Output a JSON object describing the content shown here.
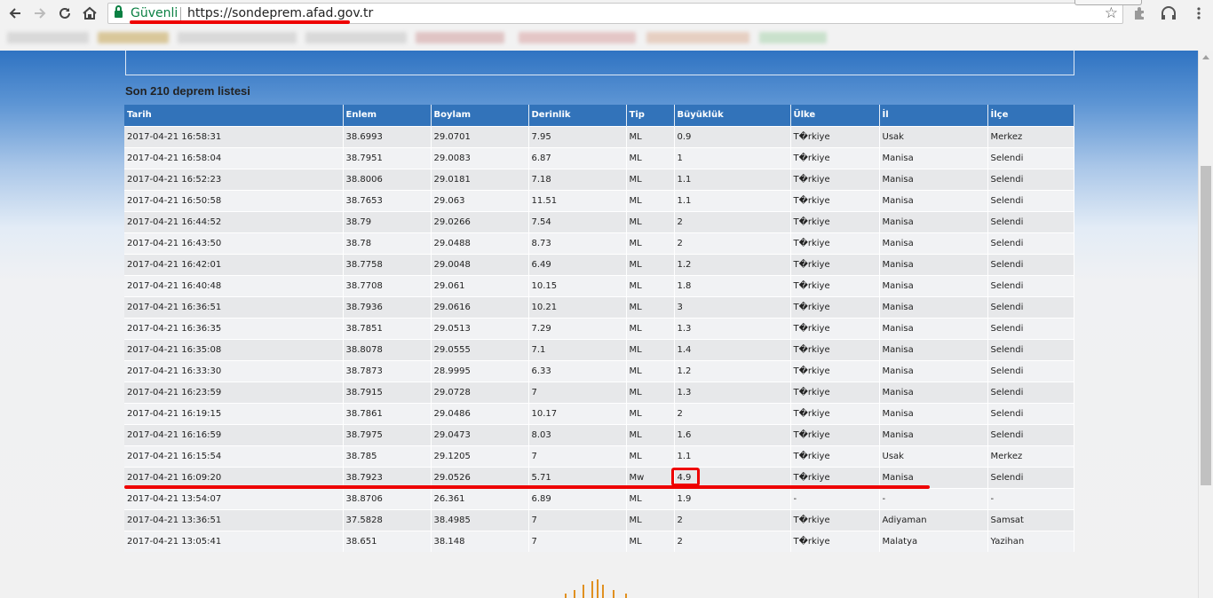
{
  "browser": {
    "secure_label": "Güvenli",
    "url": "https://sondeprem.afad.gov.tr",
    "icons": [
      "back-arrow-icon",
      "forward-arrow-icon",
      "reload-icon",
      "home-icon",
      "lock-icon",
      "star-icon",
      "puzzle-icon",
      "headphones-icon",
      "menu-dots-icon"
    ]
  },
  "page": {
    "section_title": "Son 210 deprem listesi"
  },
  "table": {
    "headers": [
      "Tarih",
      "Enlem",
      "Boylam",
      "Derinlik",
      "Tip",
      "Büyüklük",
      "Ülke",
      "İl",
      "İlçe"
    ],
    "rows": [
      [
        "2017-04-21 16:58:31",
        "38.6993",
        "29.0701",
        "7.95",
        "ML",
        "0.9",
        "T�rkiye",
        "Usak",
        "Merkez"
      ],
      [
        "2017-04-21 16:58:04",
        "38.7951",
        "29.0083",
        "6.87",
        "ML",
        "1",
        "T�rkiye",
        "Manisa",
        "Selendi"
      ],
      [
        "2017-04-21 16:52:23",
        "38.8006",
        "29.0181",
        "7.18",
        "ML",
        "1.1",
        "T�rkiye",
        "Manisa",
        "Selendi"
      ],
      [
        "2017-04-21 16:50:58",
        "38.7653",
        "29.063",
        "11.51",
        "ML",
        "1.1",
        "T�rkiye",
        "Manisa",
        "Selendi"
      ],
      [
        "2017-04-21 16:44:52",
        "38.79",
        "29.0266",
        "7.54",
        "ML",
        "2",
        "T�rkiye",
        "Manisa",
        "Selendi"
      ],
      [
        "2017-04-21 16:43:50",
        "38.78",
        "29.0488",
        "8.73",
        "ML",
        "2",
        "T�rkiye",
        "Manisa",
        "Selendi"
      ],
      [
        "2017-04-21 16:42:01",
        "38.7758",
        "29.0048",
        "6.49",
        "ML",
        "1.2",
        "T�rkiye",
        "Manisa",
        "Selendi"
      ],
      [
        "2017-04-21 16:40:48",
        "38.7708",
        "29.061",
        "10.15",
        "ML",
        "1.8",
        "T�rkiye",
        "Manisa",
        "Selendi"
      ],
      [
        "2017-04-21 16:36:51",
        "38.7936",
        "29.0616",
        "10.21",
        "ML",
        "3",
        "T�rkiye",
        "Manisa",
        "Selendi"
      ],
      [
        "2017-04-21 16:36:35",
        "38.7851",
        "29.0513",
        "7.29",
        "ML",
        "1.3",
        "T�rkiye",
        "Manisa",
        "Selendi"
      ],
      [
        "2017-04-21 16:35:08",
        "38.8078",
        "29.0555",
        "7.1",
        "ML",
        "1.4",
        "T�rkiye",
        "Manisa",
        "Selendi"
      ],
      [
        "2017-04-21 16:33:30",
        "38.7873",
        "28.9995",
        "6.33",
        "ML",
        "1.2",
        "T�rkiye",
        "Manisa",
        "Selendi"
      ],
      [
        "2017-04-21 16:23:59",
        "38.7915",
        "29.0728",
        "7",
        "ML",
        "1.3",
        "T�rkiye",
        "Manisa",
        "Selendi"
      ],
      [
        "2017-04-21 16:19:15",
        "38.7861",
        "29.0486",
        "10.17",
        "ML",
        "2",
        "T�rkiye",
        "Manisa",
        "Selendi"
      ],
      [
        "2017-04-21 16:16:59",
        "38.7975",
        "29.0473",
        "8.03",
        "ML",
        "1.6",
        "T�rkiye",
        "Manisa",
        "Selendi"
      ],
      [
        "2017-04-21 16:15:54",
        "38.785",
        "29.1205",
        "7",
        "ML",
        "1.1",
        "T�rkiye",
        "Usak",
        "Merkez"
      ],
      [
        "2017-04-21 16:09:20",
        "38.7923",
        "29.0526",
        "5.71",
        "Mw",
        "4.9",
        "T�rkiye",
        "Manisa",
        "Selendi"
      ],
      [
        "2017-04-21 13:54:07",
        "38.8706",
        "26.361",
        "6.89",
        "ML",
        "1.9",
        "-",
        "-",
        "-"
      ],
      [
        "2017-04-21 13:36:51",
        "37.5828",
        "38.4985",
        "7",
        "ML",
        "2",
        "T�rkiye",
        "Adiyaman",
        "Samsat"
      ],
      [
        "2017-04-21 13:05:41",
        "38.651",
        "38.148",
        "7",
        "ML",
        "2",
        "T�rkiye",
        "Malatya",
        "Yazihan"
      ]
    ]
  }
}
